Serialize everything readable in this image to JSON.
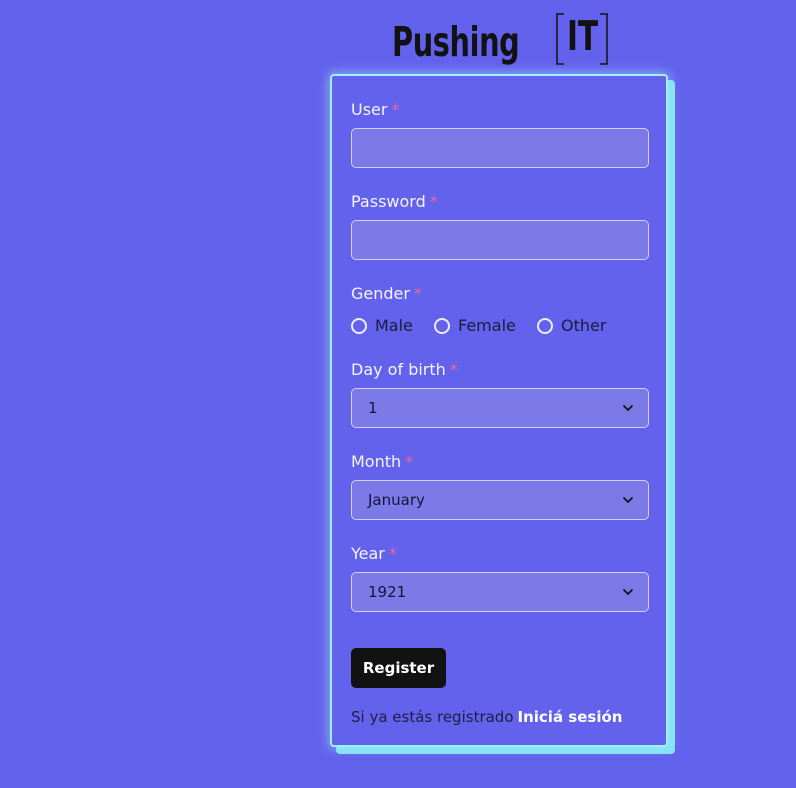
{
  "logo": {
    "word": "Pushing",
    "mark": "IT"
  },
  "form": {
    "user": {
      "label": "User",
      "required_marker": "*",
      "value": ""
    },
    "password": {
      "label": "Password",
      "required_marker": "*",
      "value": ""
    },
    "gender": {
      "label": "Gender",
      "required_marker": "*",
      "options": [
        "Male",
        "Female",
        "Other"
      ]
    },
    "day_of_birth": {
      "label": "Day of birth",
      "required_marker": "*",
      "selected": "1"
    },
    "month": {
      "label": "Month",
      "required_marker": "*",
      "selected": "January"
    },
    "year": {
      "label": "Year",
      "required_marker": "*",
      "selected": "1921"
    },
    "register_label": "Register",
    "login_prompt": "Si ya estás registrado",
    "login_link": "Iniciá sesión"
  },
  "icons": {
    "select_arrow": "chevron-down-icon",
    "gender_option": "radio-circle-icon",
    "logo_frame": "bracket-frame-icon"
  },
  "colors": {
    "background": "#6362ec",
    "card_glow": "#a4eef8",
    "card_shadow": "#86e3f2",
    "input_fill": "#7b7ae6",
    "required": "#f0659b",
    "button": "#121212"
  }
}
